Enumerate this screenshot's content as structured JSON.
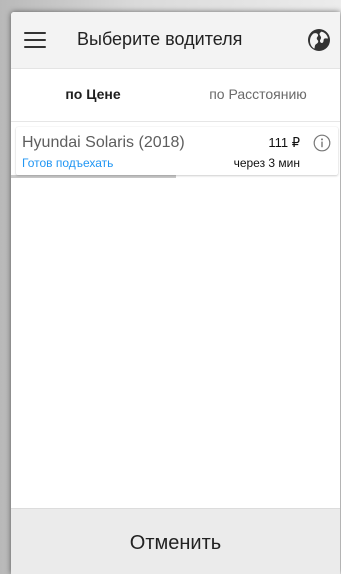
{
  "header": {
    "title": "Выберите водителя",
    "menu_icon": "hamburger-menu-icon",
    "globe_icon": "globe-icon"
  },
  "tabs": [
    {
      "label": "по Цене",
      "selected": true
    },
    {
      "label": "по Расстоянию",
      "selected": false
    }
  ],
  "drivers": [
    {
      "car": "Hyundai Solaris (2018)",
      "status": "Готов подъехать",
      "price": "111 ₽",
      "eta": "через 3 мин",
      "info_icon": "info-icon"
    }
  ],
  "footer": {
    "cancel_label": "Отменить"
  },
  "colors": {
    "accent_blue": "#2196f3",
    "appbar_bg": "#f3f3f3",
    "footer_bg": "#ebebeb",
    "tab_indicator": "#c9c9c9"
  }
}
